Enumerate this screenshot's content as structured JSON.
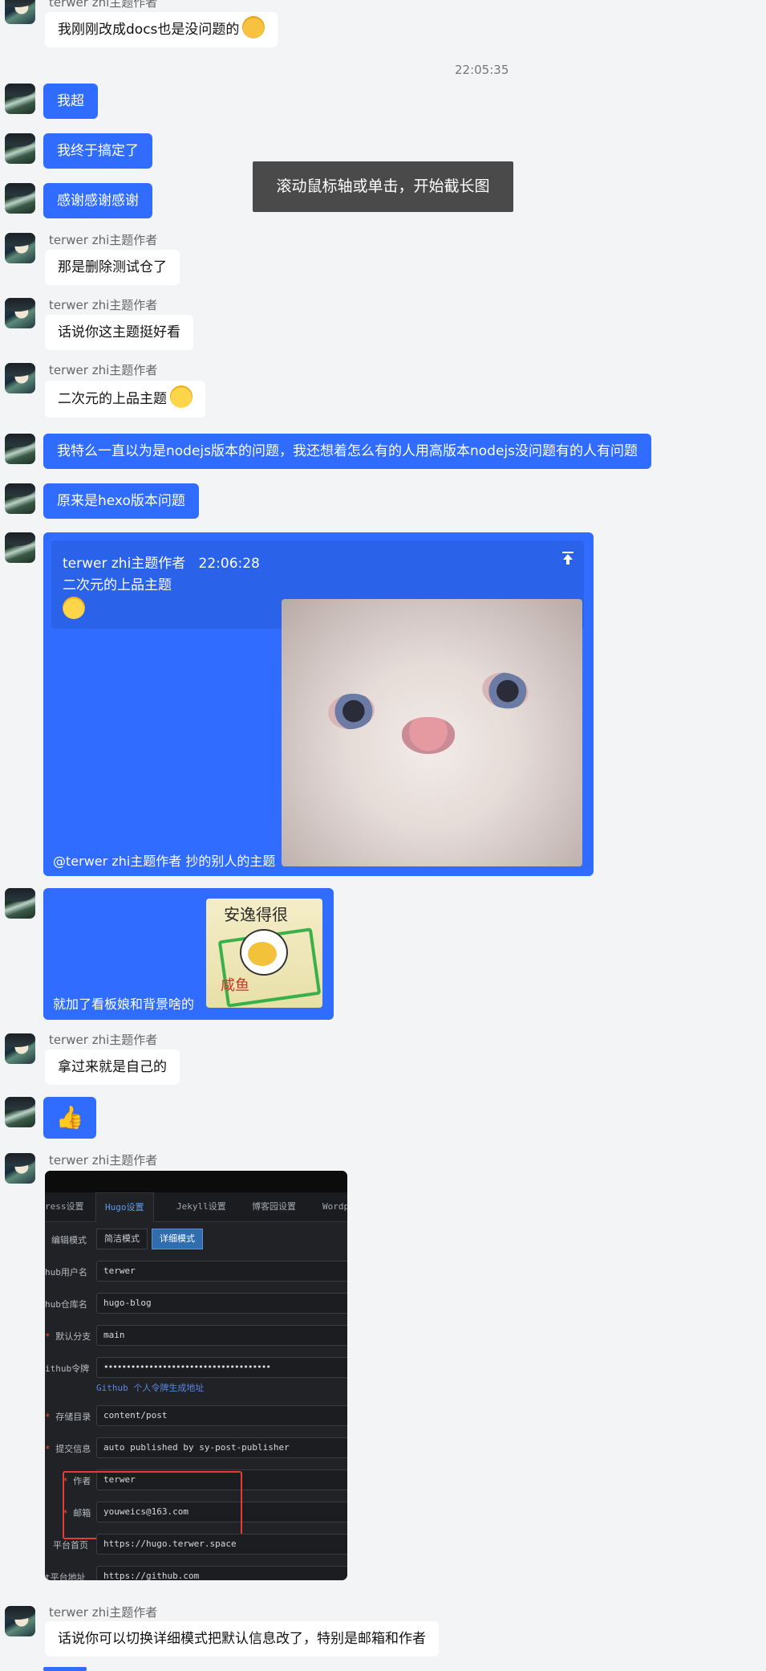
{
  "author_label": "terwer zhi主题作者",
  "timestamp": "22:05:35",
  "tooltip": "滚动鼠标轴或单击，开始截长图",
  "messages": {
    "m0": "我刚刚改成docs也是没问题的",
    "m1": "我超",
    "m2": "我终于搞定了",
    "m3": "感谢感谢感谢",
    "m4": "那是删除测试仓了",
    "m5": "话说你这主题挺好看",
    "m6": "二次元的上品主题",
    "m7": "我特么一直以为是nodejs版本的问题，我还想着怎么有的人用高版本nodejs没问题有的人有问题",
    "m8": "原来是hexo版本问题",
    "m9_mention": "@terwer zhi主题作者",
    "m9_text": "抄的别人的主题",
    "m10": "就加了看板娘和背景啥的",
    "m11": "拿过来就是自己的",
    "m12": "👍",
    "m13": "话说你可以切换详细模式把默认信息改了，特别是邮箱和作者"
  },
  "quote": {
    "author": "terwer zhi主题作者",
    "time": "22:06:28",
    "text": "二次元的上品主题"
  },
  "sticker_text": {
    "top": "安逸得很",
    "side": "咸鱼"
  },
  "settings_screenshot": {
    "tabs": [
      "ress设置",
      "Hugo设置",
      "Jekyll设置",
      "博客园设置",
      "Wordp"
    ],
    "active_tab": "Hugo设置",
    "edit_mode_label": "编辑模式",
    "mode_simple": "简洁模式",
    "mode_detail": "详细模式",
    "rows": [
      {
        "label": "hub用户名",
        "value": "terwer",
        "required": false
      },
      {
        "label": "hub仓库名",
        "value": "hugo-blog",
        "required": false
      },
      {
        "label": "默认分支",
        "value": "main",
        "required": true
      },
      {
        "label": "ithub令牌",
        "value": "•••••••••••••••••••••••••••••••••••••",
        "required": false
      },
      {
        "label": "存储目录",
        "value": "content/post",
        "required": true
      },
      {
        "label": "提交信息",
        "value": "auto published by sy-post-publisher",
        "required": true
      },
      {
        "label": "作者",
        "value": "terwer",
        "required": true
      },
      {
        "label": "邮箱",
        "value": "youweics@163.com",
        "required": true
      },
      {
        "label": "平台首页",
        "value": "https://hugo.terwer.space",
        "required": false
      },
      {
        "label": "t平台地址",
        "value": "https://github.com",
        "required": false
      }
    ],
    "token_link": "Github 个人令牌生成地址"
  }
}
